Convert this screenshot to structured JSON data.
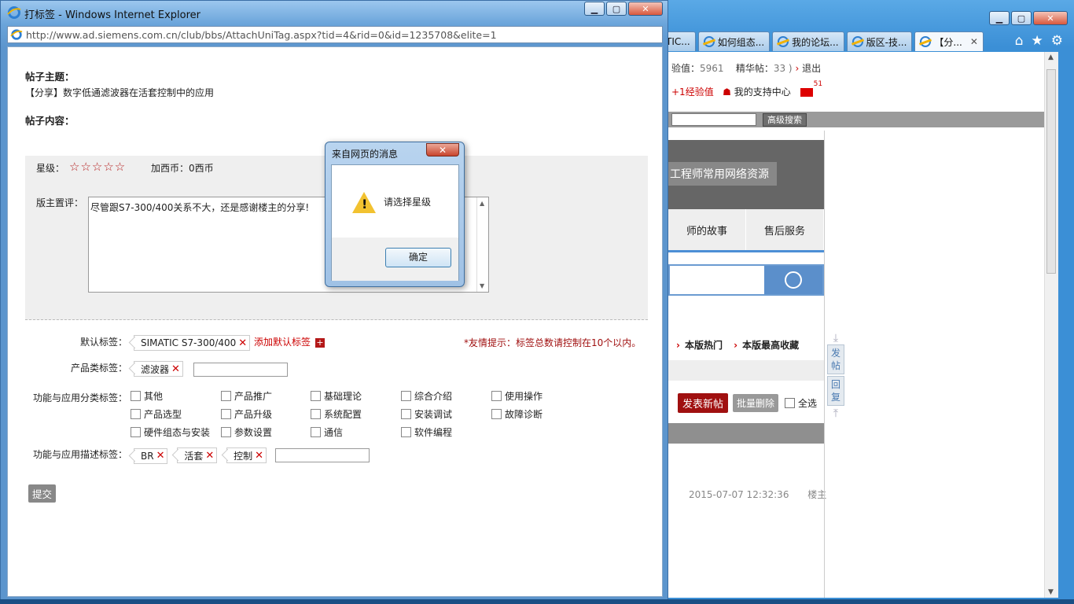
{
  "background_window": {
    "tabs": [
      "TIC...",
      "如何组态...",
      "我的论坛...",
      "版区-技...",
      "【分..."
    ],
    "close_glyph": "✕",
    "tools": [
      "home-icon",
      "star-icon",
      "gear-icon"
    ],
    "stats_label_exp": "验值：",
    "stats_exp_value": "5961",
    "stats_label_elite": "精华帖：",
    "stats_elite_value": "33 )",
    "logout": "退出",
    "exp_plus": "+1经验值",
    "support_center": "我的支持中心",
    "mail_count": "51",
    "advanced_search": "高级搜索",
    "banner_text": "工程师常用网络资源",
    "nav_items": [
      "师的故事",
      "售后服务"
    ],
    "hot_items": [
      "本版热门",
      "本版最高收藏"
    ],
    "new_post_btn": "发表新帖",
    "batch_delete_btn": "批量删除",
    "select_all": "全选",
    "timestamp": "2015-07-07 12:32:36",
    "floor_owner": "楼主",
    "side_post": "发帖",
    "side_reply": "回复"
  },
  "popup": {
    "title": "打标签 - Windows Internet Explorer",
    "url": "http://www.ad.siemens.com.cn/club/bbs/AttachUniTag.aspx?tid=4&rid=0&id=1235708&elite=1",
    "topic_label": "帖子主题：",
    "topic_value": "【分享】数字低通滤波器在活套控制中的应用",
    "content_label": "帖子内容：",
    "star_label": "星级：",
    "stars": "☆☆☆☆☆",
    "coin_label": "加西币：0西币",
    "moderator_label": "版主置评：",
    "comment_text": "尽管跟S7-300/400关系不大，还是感谢楼主的分享!",
    "default_tag_label": "默认标签：",
    "default_tags": [
      "SIMATIC S7-300/400"
    ],
    "add_default_tag": "添加默认标签",
    "hint": "*友情提示：标签总数请控制在10个以内。",
    "product_tag_label": "产品类标签：",
    "product_tags": [
      "滤波器"
    ],
    "func_class_label": "功能与应用分类标签：",
    "func_class_options": [
      [
        "其他",
        "产品推广",
        "基础理论",
        "综合介绍",
        "使用操作"
      ],
      [
        "产品选型",
        "产品升级",
        "系统配置",
        "安装调试",
        "故障诊断"
      ],
      [
        "硬件组态与安装",
        "参数设置",
        "通信",
        "软件编程"
      ]
    ],
    "func_desc_label": "功能与应用描述标签：",
    "func_desc_tags": [
      "BR",
      "活套",
      "控制"
    ],
    "submit": "提交"
  },
  "dialog": {
    "title": "来自网页的消息",
    "message": "请选择星级",
    "ok": "确定",
    "icon": "warning-icon"
  }
}
